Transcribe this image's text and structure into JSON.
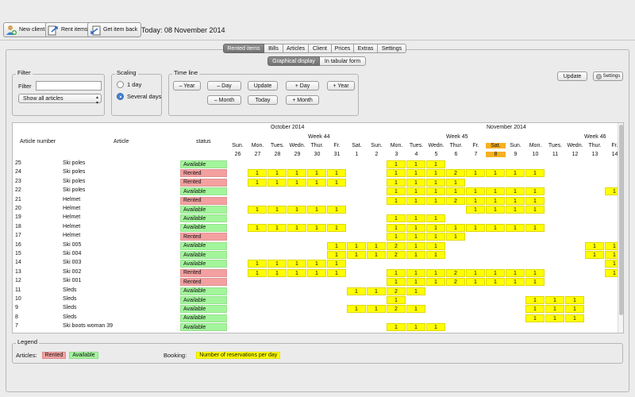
{
  "toolbar": {
    "new_client": "New client",
    "rent_items": "Rent items",
    "get_item_back": "Get item back",
    "today": "Today: 08 November 2014"
  },
  "tabs": [
    "Rented items",
    "Bills",
    "Articles",
    "Client",
    "Prices",
    "Extras",
    "Settings"
  ],
  "active_tab": "Rented items",
  "subtabs": [
    "Graphical display",
    "In tabular form"
  ],
  "active_subtab": "Graphical display",
  "filter": {
    "title": "Filter",
    "label": "Filter",
    "value": "",
    "select_value": "Show all articles"
  },
  "scaling": {
    "title": "Scaling",
    "option1": "1 day",
    "option2": "Several days",
    "selected": "Several days"
  },
  "timeline": {
    "title": "Time line",
    "minus_year": "– Year",
    "minus_day": "– Day",
    "update": "Update",
    "plus_day": "+ Day",
    "plus_year": "+ Year",
    "minus_month": "– Month",
    "today": "Today",
    "plus_month": "+ Month"
  },
  "right_buttons": {
    "update": "Update",
    "settings": "Settings"
  },
  "grid": {
    "col_article_number": "Article number",
    "col_article": "Article",
    "col_status": "status",
    "month_oct": "October 2014",
    "month_nov": "November 2014",
    "week44": "Week 44",
    "week45": "Week 45",
    "week46": "Week 46",
    "days": [
      {
        "w": "Sun.",
        "d": "26"
      },
      {
        "w": "Mon.",
        "d": "27"
      },
      {
        "w": "Tues.",
        "d": "28"
      },
      {
        "w": "Wedn.",
        "d": "29"
      },
      {
        "w": "Thur.",
        "d": "30"
      },
      {
        "w": "Fr.",
        "d": "31"
      },
      {
        "w": "Sat.",
        "d": "1"
      },
      {
        "w": "Sun.",
        "d": "2"
      },
      {
        "w": "Mon.",
        "d": "3"
      },
      {
        "w": "Tues.",
        "d": "4"
      },
      {
        "w": "Wedn.",
        "d": "5"
      },
      {
        "w": "Thur.",
        "d": "6"
      },
      {
        "w": "Fr.",
        "d": "7"
      },
      {
        "w": "Sat.",
        "d": "8"
      },
      {
        "w": "Sun.",
        "d": "9"
      },
      {
        "w": "Mon.",
        "d": "10"
      },
      {
        "w": "Tues.",
        "d": "11"
      },
      {
        "w": "Wedn.",
        "d": "12"
      },
      {
        "w": "Thur.",
        "d": "13"
      },
      {
        "w": "Fr.",
        "d": "14"
      }
    ],
    "highlight_day_index": 13,
    "rows": [
      {
        "num": "25",
        "article": "Ski poles",
        "status": "Available",
        "cells": {
          "8": "1",
          "9": "1",
          "10": "1"
        }
      },
      {
        "num": "24",
        "article": "Ski poles",
        "status": "Rented",
        "cells": {
          "1": "1",
          "2": "1",
          "3": "1",
          "4": "1",
          "5": "1",
          "8": "1",
          "9": "1",
          "10": "1",
          "11": "2",
          "12": "1",
          "13": "1",
          "14": "1",
          "15": "1"
        }
      },
      {
        "num": "23",
        "article": "Ski poles",
        "status": "Rented",
        "cells": {
          "1": "1",
          "2": "1",
          "3": "1",
          "4": "1",
          "5": "1",
          "8": "1",
          "9": "1",
          "10": "1",
          "11": "1"
        }
      },
      {
        "num": "22",
        "article": "Ski poles",
        "status": "Available",
        "cells": {
          "8": "1",
          "9": "1",
          "10": "1",
          "11": "1",
          "12": "1",
          "13": "1",
          "14": "1",
          "15": "1",
          "19": "1"
        }
      },
      {
        "num": "21",
        "article": "Helmet",
        "status": "Rented",
        "cells": {
          "8": "1",
          "9": "1",
          "10": "1",
          "11": "2",
          "12": "1",
          "13": "1",
          "14": "1",
          "15": "1"
        }
      },
      {
        "num": "20",
        "article": "Helmet",
        "status": "Available",
        "cells": {
          "1": "1",
          "2": "1",
          "3": "1",
          "4": "1",
          "5": "1",
          "12": "1",
          "13": "1",
          "14": "1",
          "15": "1"
        }
      },
      {
        "num": "19",
        "article": "Helmet",
        "status": "Available",
        "cells": {
          "8": "1",
          "9": "1",
          "10": "1"
        }
      },
      {
        "num": "18",
        "article": "Helmet",
        "status": "Available",
        "cells": {
          "1": "1",
          "2": "1",
          "3": "1",
          "4": "1",
          "5": "1",
          "8": "1",
          "9": "1",
          "10": "1",
          "11": "1",
          "12": "1",
          "13": "1",
          "14": "1",
          "15": "1"
        }
      },
      {
        "num": "17",
        "article": "Helmet",
        "status": "Rented",
        "cells": {
          "8": "1",
          "9": "1",
          "10": "1",
          "11": "1"
        }
      },
      {
        "num": "16",
        "article": "Ski 005",
        "status": "Available",
        "cells": {
          "5": "1",
          "6": "1",
          "7": "1",
          "8": "2",
          "9": "1",
          "10": "1",
          "18": "1",
          "19": "1"
        }
      },
      {
        "num": "15",
        "article": "Ski 004",
        "status": "Available",
        "cells": {
          "5": "1",
          "6": "1",
          "7": "1",
          "8": "2",
          "9": "1",
          "10": "1",
          "18": "1",
          "19": "1"
        }
      },
      {
        "num": "14",
        "article": "Ski 003",
        "status": "Available",
        "cells": {
          "1": "1",
          "2": "1",
          "3": "1",
          "4": "1",
          "5": "1",
          "19": "1"
        }
      },
      {
        "num": "13",
        "article": "Ski 002",
        "status": "Rented",
        "cells": {
          "1": "1",
          "2": "1",
          "3": "1",
          "4": "1",
          "5": "1",
          "8": "1",
          "9": "1",
          "10": "1",
          "11": "2",
          "12": "1",
          "13": "1",
          "14": "1",
          "15": "1",
          "19": "1"
        }
      },
      {
        "num": "12",
        "article": "Ski 001",
        "status": "Rented",
        "cells": {
          "8": "1",
          "9": "1",
          "10": "1",
          "11": "2",
          "12": "1",
          "13": "1",
          "14": "1",
          "15": "1"
        }
      },
      {
        "num": "11",
        "article": "Sleds",
        "status": "Available",
        "cells": {
          "6": "1",
          "7": "1",
          "8": "2",
          "9": "1"
        }
      },
      {
        "num": "10",
        "article": "Sleds",
        "status": "Available",
        "cells": {
          "8": "1",
          "15": "1",
          "16": "1",
          "17": "1"
        }
      },
      {
        "num": "9",
        "article": "Sleds",
        "status": "Available",
        "cells": {
          "6": "1",
          "7": "1",
          "8": "2",
          "9": "1",
          "15": "1",
          "16": "1",
          "17": "1"
        }
      },
      {
        "num": "8",
        "article": "Sleds",
        "status": "Available",
        "cells": {
          "15": "1",
          "16": "1",
          "17": "1"
        }
      },
      {
        "num": "7",
        "article": "Ski boots woman 39",
        "status": "Available",
        "cells": {
          "8": "1",
          "9": "1",
          "10": "1"
        }
      }
    ]
  },
  "legend": {
    "title": "Legend",
    "articles_label": "Articles:",
    "rented": "Rented",
    "available": "Available",
    "booking_label": "Booking:",
    "booking_text": "Number of reservations per day"
  },
  "colors": {
    "rented": "#f4a0a0",
    "available": "#a3f59b",
    "booking": "#ffff00",
    "highlight": "#f5b021"
  }
}
